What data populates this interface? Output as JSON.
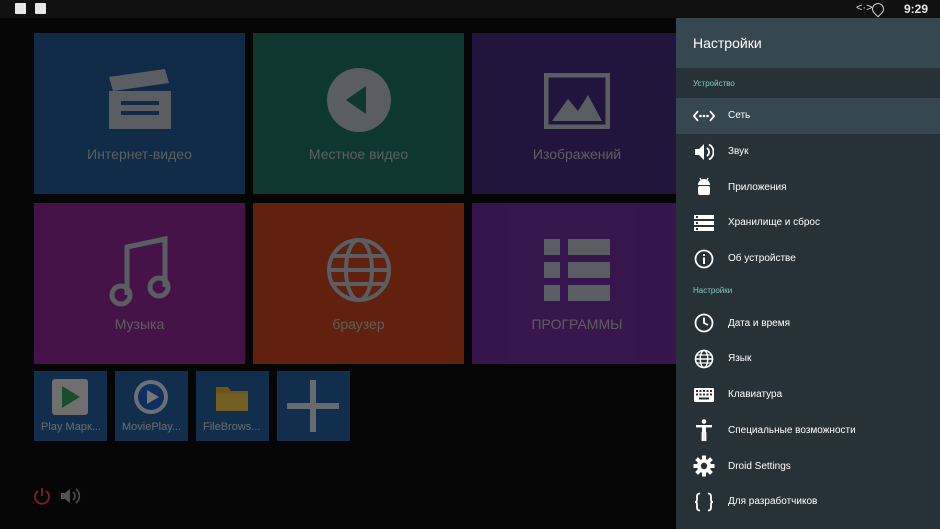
{
  "status_bar": {
    "time": "9:29",
    "eth_glyph": "<·>",
    "left_icons": [
      "a-notification-icon",
      "image-notification-icon"
    ],
    "right_icons": [
      "ethernet-icon",
      "wifi-icon"
    ]
  },
  "home": {
    "tiles": [
      {
        "label": "Интернет-видео",
        "color": "#2061a3",
        "icon": "clapperboard-icon"
      },
      {
        "label": "Местное видео",
        "color": "#1b7f6a",
        "icon": "play-circle-icon"
      },
      {
        "label": "Изображений",
        "color": "#4a2d8a",
        "icon": "image-icon"
      },
      {
        "label": "Музыка",
        "color": "#a028a8",
        "icon": "music-note-icon"
      },
      {
        "label": "браузер",
        "color": "#e0481b",
        "icon": "globe-icon"
      },
      {
        "label": "ПРОГРАММЫ",
        "color": "#7d2bb0",
        "icon": "grid-list-icon"
      }
    ],
    "apps": [
      {
        "label": "Play Марк...",
        "icon": "play-store-icon"
      },
      {
        "label": "MoviePlay...",
        "icon": "movieplayer-icon"
      },
      {
        "label": "FileBrows...",
        "icon": "folder-icon"
      },
      {
        "label": "",
        "icon": "plus-icon"
      }
    ],
    "bottom_icons": [
      "power-icon",
      "volume-icon"
    ],
    "colors": {
      "power": "#e53935",
      "volume": "#9e9e9e"
    }
  },
  "settings": {
    "title": "Настройки",
    "colors": {
      "panel": "#263238",
      "header": "#37474f",
      "section": "#80cbc4",
      "selected": "#37474f"
    },
    "sections": [
      {
        "header": "Устройство",
        "items": [
          {
            "label": "Сеть",
            "icon": "network-icon",
            "selected": true
          },
          {
            "label": "Звук",
            "icon": "speaker-icon"
          },
          {
            "label": "Приложения",
            "icon": "android-icon"
          },
          {
            "label": "Хранилище и сброс",
            "icon": "storage-icon"
          },
          {
            "label": "Об устройстве",
            "icon": "info-icon"
          }
        ]
      },
      {
        "header": "Настройки",
        "items": [
          {
            "label": "Дата и время",
            "icon": "clock-icon"
          },
          {
            "label": "Язык",
            "icon": "globe-icon"
          },
          {
            "label": "Клавиатура",
            "icon": "keyboard-icon"
          },
          {
            "label": "Специальные возможности",
            "icon": "accessibility-icon"
          },
          {
            "label": "Droid Settings",
            "icon": "gear-icon"
          },
          {
            "label": "Для разработчиков",
            "icon": "braces-icon"
          }
        ]
      }
    ]
  }
}
